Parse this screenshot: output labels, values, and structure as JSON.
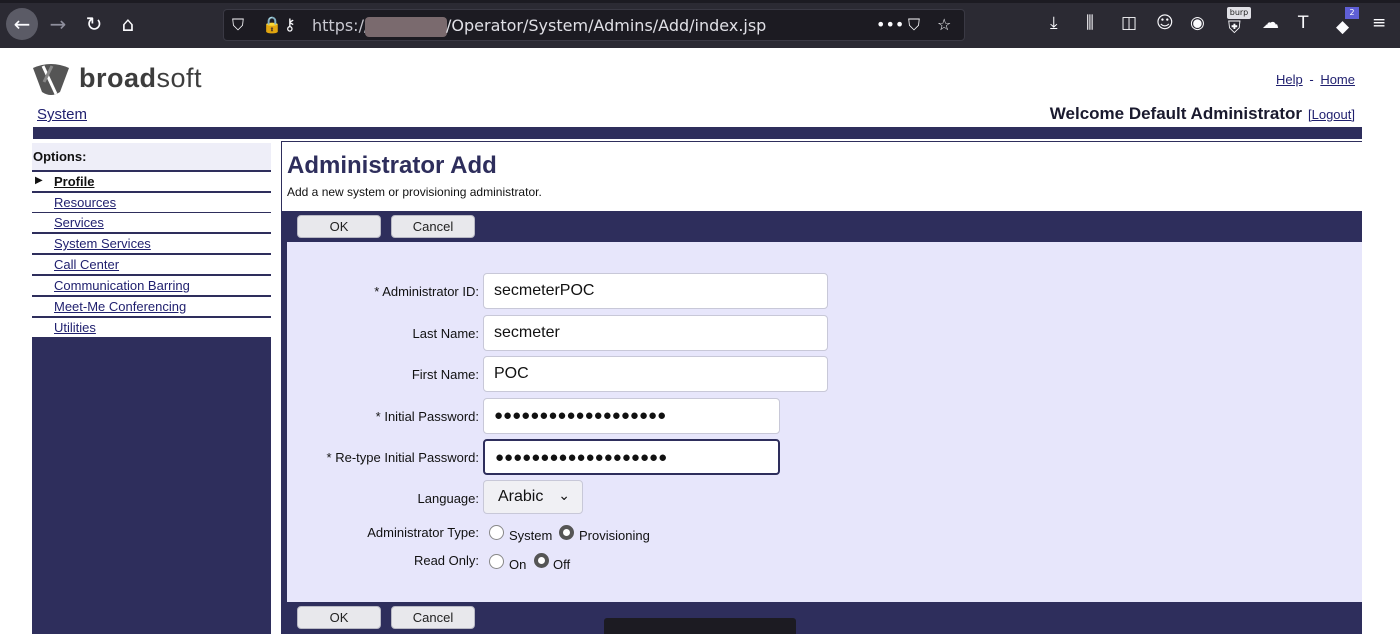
{
  "browser": {
    "url_prefix": "https://",
    "url_path": "/Operator/System/Admins/Add/index.jsp",
    "burp_badge": "burp",
    "addon_badge": "2"
  },
  "header": {
    "logo_text_bold": "broad",
    "logo_text_rest": "soft",
    "help_link": "Help",
    "separator": "-",
    "home_link": "Home",
    "system_link": "System",
    "welcome_text": "Welcome Default Administrator",
    "logout_link": "[Logout]"
  },
  "sidebar": {
    "heading": "Options:",
    "items": [
      {
        "label": "Profile",
        "active": true
      },
      {
        "label": "Resources"
      },
      {
        "label": "Services"
      },
      {
        "label": "System Services"
      },
      {
        "label": "Call Center"
      },
      {
        "label": "Communication Barring"
      },
      {
        "label": "Meet-Me Conferencing"
      },
      {
        "label": "Utilities"
      }
    ]
  },
  "main": {
    "title": "Administrator Add",
    "description": "Add a new system or provisioning administrator.",
    "ok_label": "OK",
    "cancel_label": "Cancel"
  },
  "form": {
    "admin_id_label": "* Administrator ID:",
    "admin_id_value": "secmeterPOC",
    "last_name_label": "Last Name:",
    "last_name_value": "secmeter",
    "first_name_label": "First Name:",
    "first_name_value": "POC",
    "password_label": "* Initial Password:",
    "password_value": "●●●●●●●●●●●●●●●●●●●",
    "retype_label": "* Re-type Initial Password:",
    "retype_value": "●●●●●●●●●●●●●●●●●●●",
    "language_label": "Language:",
    "language_value": "Arabic",
    "admin_type_label": "Administrator Type:",
    "admin_type_options": [
      "System",
      "Provisioning"
    ],
    "admin_type_selected": "Provisioning",
    "read_only_label": "Read Only:",
    "read_only_options": [
      "On",
      "Off"
    ],
    "read_only_selected": "Off"
  },
  "colors": {
    "brand_navy": "#2e2e5c",
    "form_bg": "#e7e6fb",
    "link": "#1f1f6e"
  }
}
